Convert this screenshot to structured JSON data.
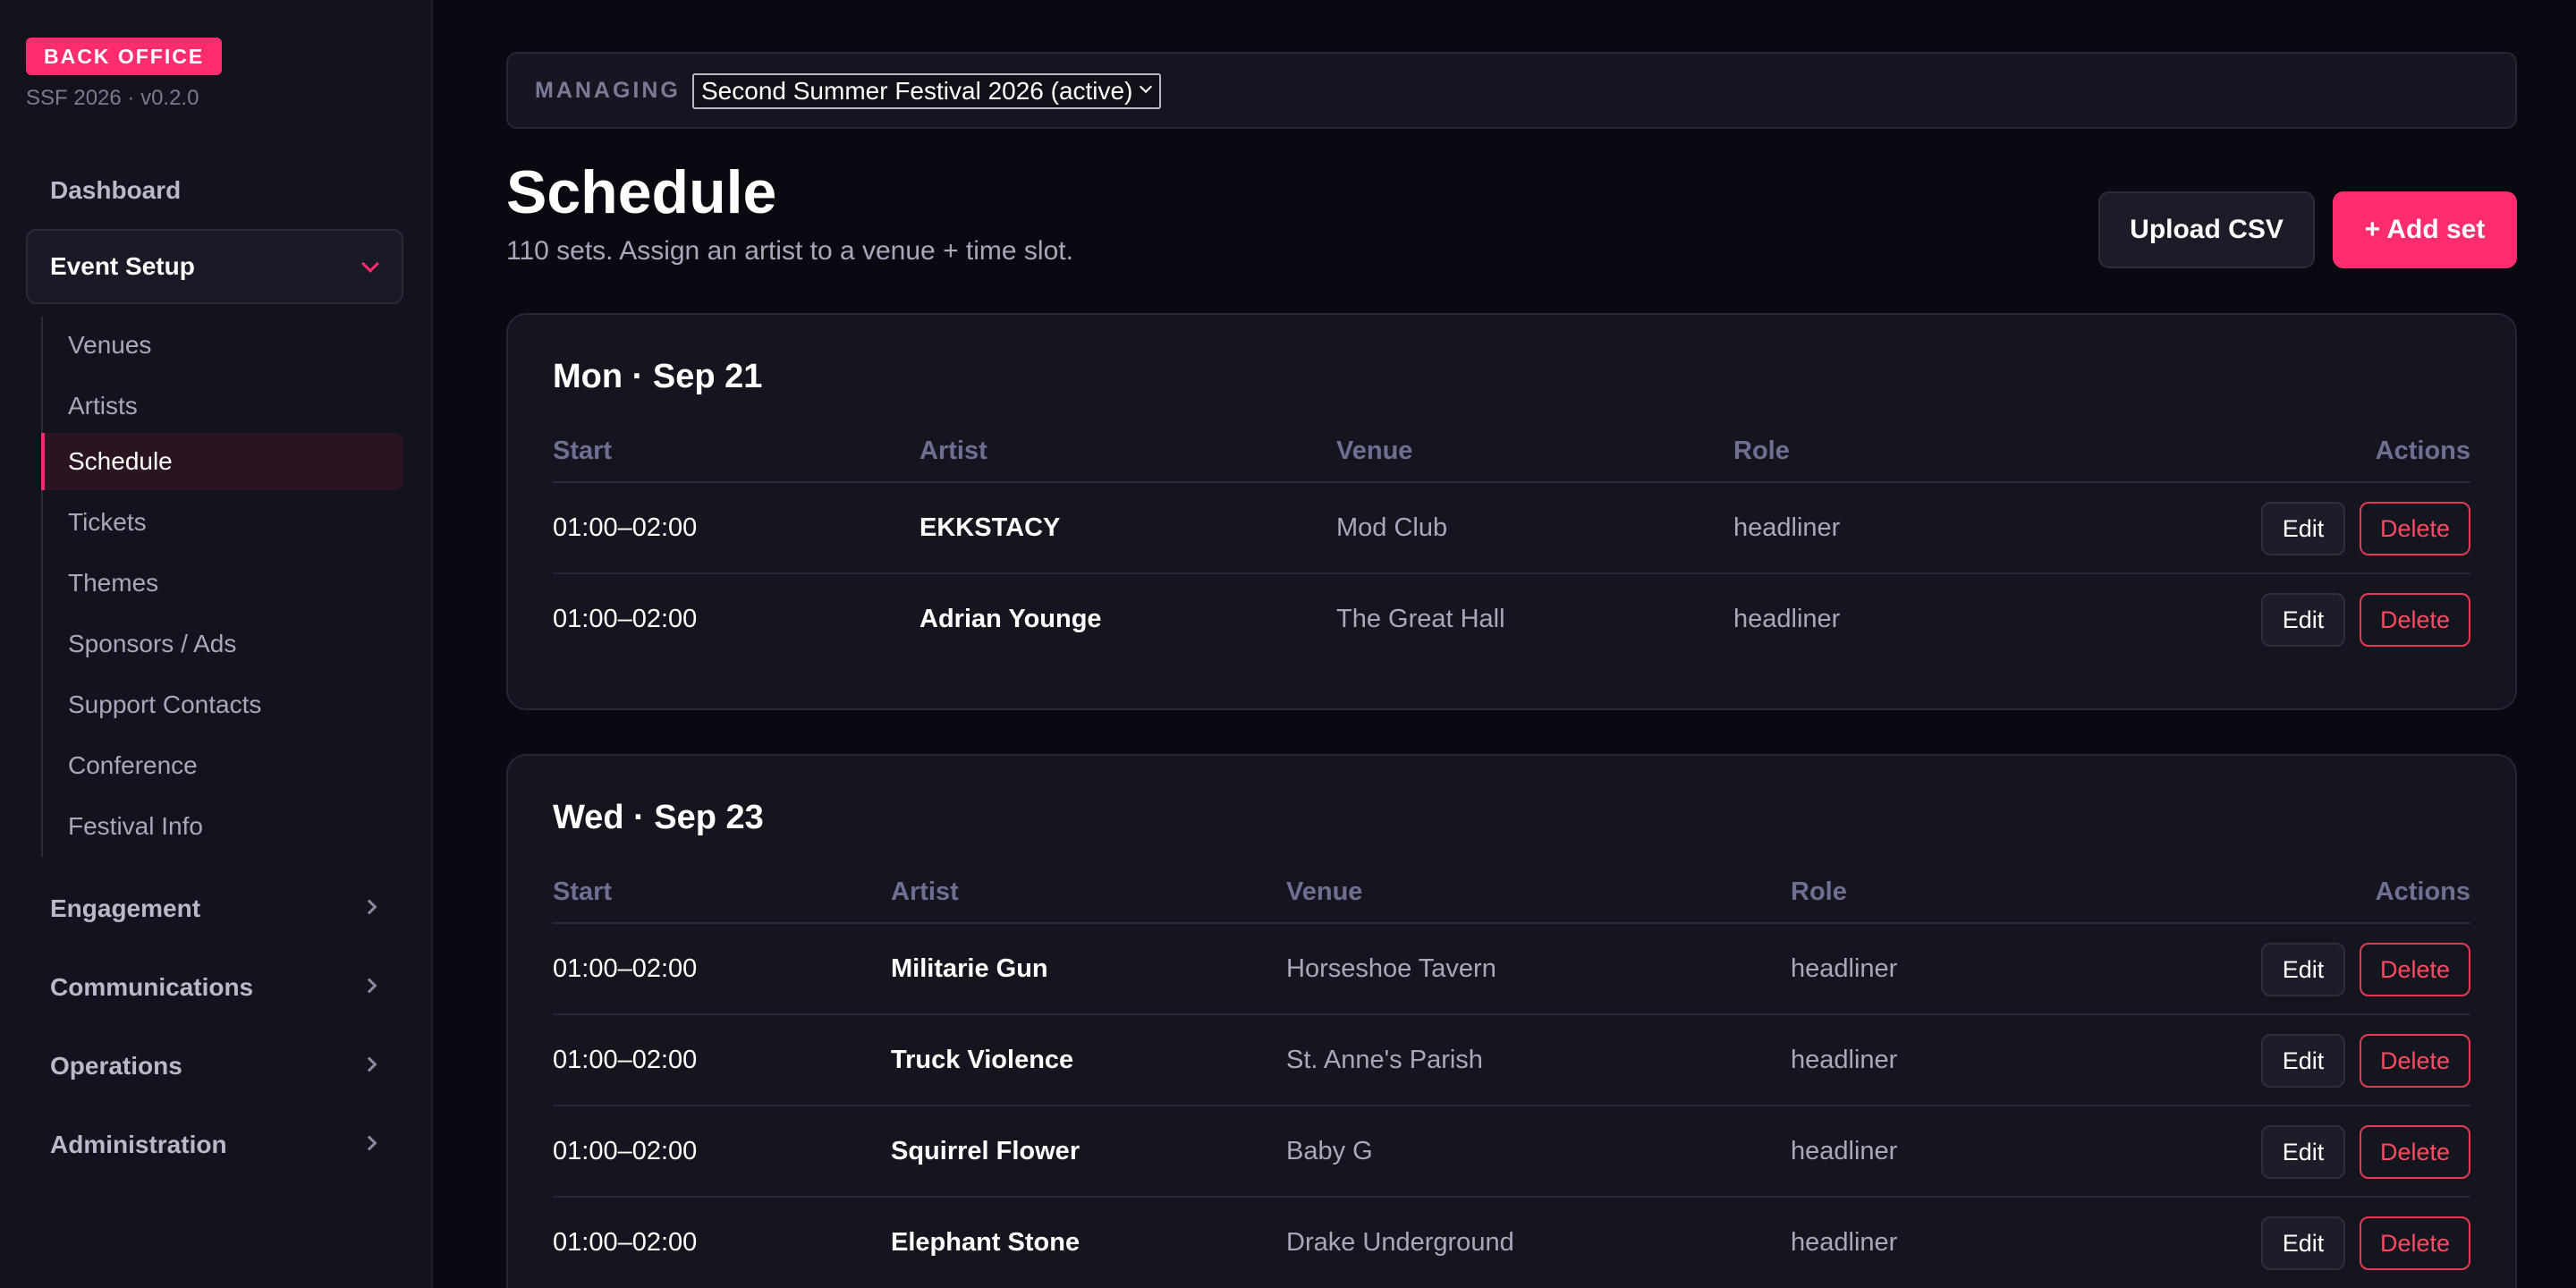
{
  "sidebar": {
    "badge": "BACK OFFICE",
    "version": "SSF 2026 · v0.2.0",
    "dashboard": "Dashboard",
    "event_setup": {
      "label": "Event Setup",
      "items": [
        {
          "label": "Venues",
          "active": false
        },
        {
          "label": "Artists",
          "active": false
        },
        {
          "label": "Schedule",
          "active": true
        },
        {
          "label": "Tickets",
          "active": false
        },
        {
          "label": "Themes",
          "active": false
        },
        {
          "label": "Sponsors / Ads",
          "active": false
        },
        {
          "label": "Support Contacts",
          "active": false
        },
        {
          "label": "Conference",
          "active": false
        },
        {
          "label": "Festival Info",
          "active": false
        }
      ]
    },
    "groups": [
      {
        "label": "Engagement"
      },
      {
        "label": "Communications"
      },
      {
        "label": "Operations"
      },
      {
        "label": "Administration"
      }
    ]
  },
  "managing": {
    "label": "MANAGING",
    "selected": "Second Summer Festival 2026 (active)"
  },
  "header": {
    "title": "Schedule",
    "subtitle": "110 sets. Assign an artist to a venue + time slot.",
    "upload_label": "Upload CSV",
    "add_label": "+ Add set"
  },
  "columns": {
    "start": "Start",
    "artist": "Artist",
    "venue": "Venue",
    "role": "Role",
    "actions": "Actions"
  },
  "actions": {
    "edit": "Edit",
    "delete": "Delete"
  },
  "days": [
    {
      "title": "Mon · Sep 21",
      "rows": [
        {
          "start": "01:00–02:00",
          "artist": "EKKSTACY",
          "venue": "Mod Club",
          "role": "headliner"
        },
        {
          "start": "01:00–02:00",
          "artist": "Adrian Younge",
          "venue": "The Great Hall",
          "role": "headliner"
        }
      ]
    },
    {
      "title": "Wed · Sep 23",
      "rows": [
        {
          "start": "01:00–02:00",
          "artist": "Militarie Gun",
          "venue": "Horseshoe Tavern",
          "role": "headliner"
        },
        {
          "start": "01:00–02:00",
          "artist": "Truck Violence",
          "venue": "St. Anne's Parish",
          "role": "headliner"
        },
        {
          "start": "01:00–02:00",
          "artist": "Squirrel Flower",
          "venue": "Baby G",
          "role": "headliner"
        },
        {
          "start": "01:00–02:00",
          "artist": "Elephant Stone",
          "venue": "Drake Underground",
          "role": "headliner"
        }
      ]
    }
  ]
}
